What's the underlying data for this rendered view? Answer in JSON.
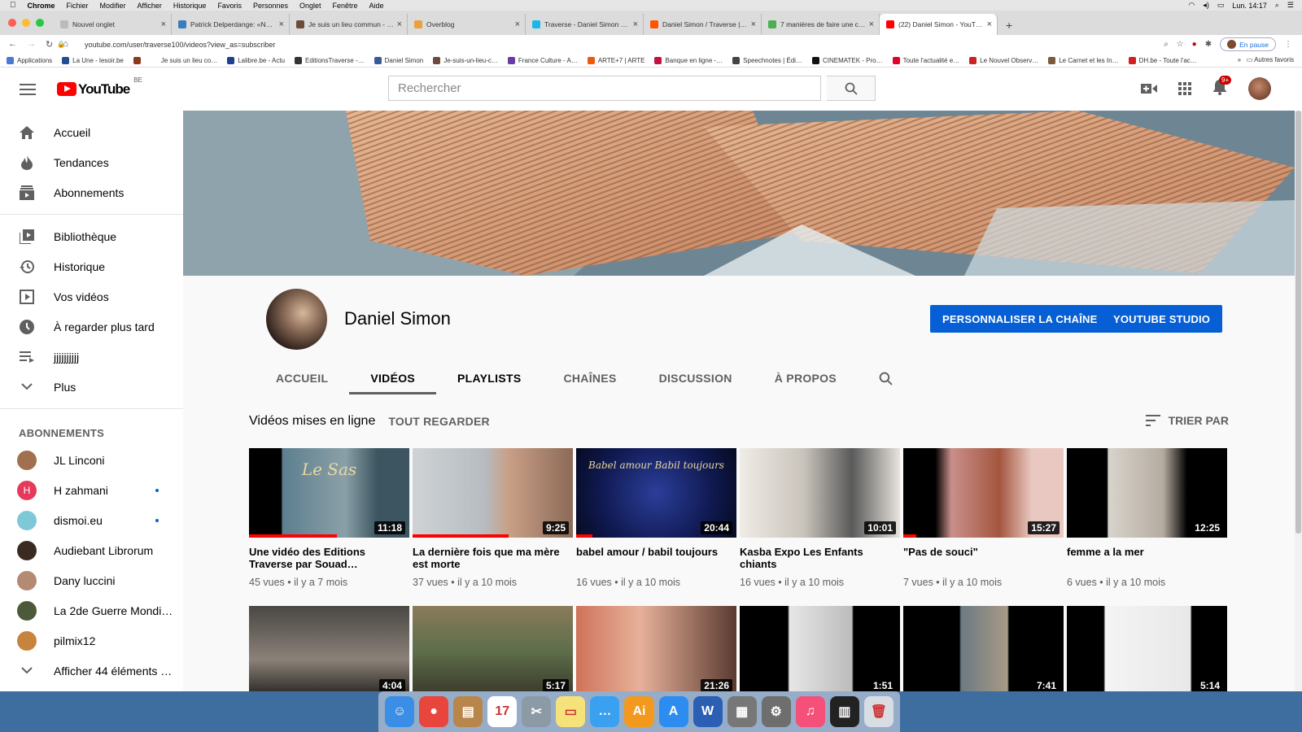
{
  "menubar": {
    "items": [
      "Chrome",
      "Fichier",
      "Modifier",
      "Afficher",
      "Historique",
      "Favoris",
      "Personnes",
      "Onglet",
      "Fenêtre",
      "Aide"
    ],
    "clock": "Lun. 14:17"
  },
  "tabs": [
    {
      "title": "Nouvel onglet",
      "color": "#bbbbbb"
    },
    {
      "title": "Patrick Delperdange: «Nous a…",
      "color": "#3b7bbf"
    },
    {
      "title": "Je suis un lieu commun - Jour…",
      "color": "#6d4b3b"
    },
    {
      "title": "Overblog",
      "color": "#e9a23b"
    },
    {
      "title": "Traverse - Daniel Simon sur Vi…",
      "color": "#1ab7ea"
    },
    {
      "title": "Daniel Simon / Traverse | Écou…",
      "color": "#ff5500"
    },
    {
      "title": "7 manières de faire une captu…",
      "color": "#4caf50"
    },
    {
      "title": "(22) Daniel Simon - YouTube",
      "color": "#ff0000"
    }
  ],
  "address": {
    "url": "youtube.com/user/traverse100/videos?view_as=subscriber",
    "pause": "En pause"
  },
  "bookmarks": [
    {
      "label": "Applications",
      "color": "#4a78d4"
    },
    {
      "label": "La Une - lesoir.be",
      "color": "#1f4f8f"
    },
    {
      "label": "",
      "color": "#8a3b1f"
    },
    {
      "label": "Je suis un lieu co…",
      "color": "#ffffff"
    },
    {
      "label": "Lalibre.be - Actu",
      "color": "#1f3f8f"
    },
    {
      "label": "EditionsTraverse -…",
      "color": "#333333"
    },
    {
      "label": "Daniel Simon",
      "color": "#3b5998"
    },
    {
      "label": "Je-suis-un-lieu-c…",
      "color": "#6d4b3b"
    },
    {
      "label": "France Culture - A…",
      "color": "#6a3ba0"
    },
    {
      "label": "ARTE+7 | ARTE",
      "color": "#ea5b0c"
    },
    {
      "label": "Banque en ligne -…",
      "color": "#c0143c"
    },
    {
      "label": "Speechnotes | Édi…",
      "color": "#444444"
    },
    {
      "label": "CINEMATEK - Pro…",
      "color": "#111111"
    },
    {
      "label": "Toute l'actualité e…",
      "color": "#e0002a"
    },
    {
      "label": "Le Nouvel Observ…",
      "color": "#cc2222"
    },
    {
      "label": "Le Carnet et les In…",
      "color": "#7a5a3a"
    },
    {
      "label": "DH.be - Toute l'ac…",
      "color": "#d02020"
    }
  ],
  "bookmarks_other": "Autres favoris",
  "youtube": {
    "logo": "YouTube",
    "region": "BE",
    "search_placeholder": "Rechercher",
    "notif_count": "9+"
  },
  "sidebar": {
    "main": [
      "Accueil",
      "Tendances",
      "Abonnements"
    ],
    "library": [
      "Bibliothèque",
      "Historique",
      "Vos vidéos",
      "À regarder plus tard",
      "jjjjjjjjjj",
      "Plus"
    ],
    "subs_heading": "ABONNEMENTS",
    "subs": [
      {
        "name": "JL Linconi",
        "color": "#a0704f",
        "dot": false
      },
      {
        "name": "H zahmani",
        "color": "#e53a5c",
        "dot": true,
        "letter": "H"
      },
      {
        "name": "dismoi.eu",
        "color": "#7fc8d8",
        "dot": true
      },
      {
        "name": "Audiebant Librorum",
        "color": "#3a2b22",
        "dot": false
      },
      {
        "name": "Dany luccini",
        "color": "#b48a72",
        "dot": false
      },
      {
        "name": "La 2de Guerre Mondi…",
        "color": "#4d5a3a",
        "dot": false
      },
      {
        "name": "pilmix12",
        "color": "#c8843f",
        "dot": false
      }
    ],
    "show_more": "Afficher 44 éléments …"
  },
  "channel": {
    "name": "Daniel Simon",
    "btn_customize": "PERSONNALISER LA CHAÎNE",
    "btn_studio": "YOUTUBE STUDIO",
    "tabs": [
      "ACCUEIL",
      "VIDÉOS",
      "PLAYLISTS",
      "CHAÎNES",
      "DISCUSSION",
      "À PROPOS"
    ]
  },
  "videos_section": {
    "title": "Vidéos mises en ligne",
    "play_all": "TOUT REGARDER",
    "sort": "TRIER PAR"
  },
  "videos": [
    {
      "title": "Une vidéo des Editions Traverse par Souad…",
      "meta": "45 vues • il y a 7 mois",
      "duration": "11:18",
      "progress": 0.55,
      "bg": "linear-gradient(90deg,#000 20%,#5d7f8f 21%,#8aa0a8 60%,#3c5560 80%)",
      "label": "Le Sas"
    },
    {
      "title": "La dernière fois que ma mère est morte",
      "meta": "37 vues • il y a 10 mois",
      "duration": "9:25",
      "progress": 0.6,
      "bg": "linear-gradient(90deg,#cfd3d6 0%,#b6bcc0 45%,#c99f86 60%,#8b6a57 100%)",
      "label": ""
    },
    {
      "title": "babel amour / babil toujours",
      "meta": "16 vues • il y a 10 mois",
      "duration": "20:44",
      "progress": 0.1,
      "bg": "radial-gradient(circle at 50% 50%,#2b3e9a 0%,#101a52 60%,#050a20 100%)",
      "label": "Babel amour  Babil toujours"
    },
    {
      "title": "Kasba Expo Les Enfants chiants",
      "meta": "16 vues • il y a 10 mois",
      "duration": "10:01",
      "progress": 0,
      "bg": "linear-gradient(90deg,#f0ece6 0%,#c9c3bb 40%,#5a5a5a 70%,#e8e4de 100%)",
      "label": ""
    },
    {
      "title": "\"Pas de souci\"",
      "meta": "7 vues • il y a 10 mois",
      "duration": "15:27",
      "progress": 0.08,
      "bg": "linear-gradient(90deg,#000 20%,#c98f8a 30%,#a4563f 60%,#e8c8c0 80%)",
      "label": ""
    },
    {
      "title": "femme a la mer",
      "meta": "6 vues • il y a 10 mois",
      "duration": "12:25",
      "progress": 0,
      "bg": "linear-gradient(90deg,#000 25%,#d8d3cc 26%,#b5aca0 60%,#000 75%)",
      "label": ""
    }
  ],
  "videos_row2": [
    {
      "duration": "4:04",
      "bg": "linear-gradient(180deg,#4a4744 0%,#8b8178 60%,#2a2724 100%)"
    },
    {
      "duration": "5:17",
      "bg": "linear-gradient(180deg,#8a7b5a 0%,#5e6e4a 50%,#3a3a2a 100%)"
    },
    {
      "duration": "21:26",
      "bg": "linear-gradient(90deg,#d0735a 0%,#e7b19a 40%,#5a3a30 100%)"
    },
    {
      "duration": "1:51",
      "bg": "linear-gradient(90deg,#000 30%,#e6e6e6 31%,#bcbcbc 70%,#000 71%)"
    },
    {
      "duration": "7:41",
      "bg": "linear-gradient(90deg,#000 35%,#6b7a82 36%,#a89a86 65%,#000 66%)"
    },
    {
      "duration": "5:14",
      "bg": "linear-gradient(90deg,#000 23%,#f4f4f4 24%,#e8e8e8 77%,#000 78%)"
    }
  ],
  "dock": [
    {
      "name": "finder-icon",
      "color": "#3a8ee6",
      "glyph": "☺"
    },
    {
      "name": "chrome-icon",
      "color": "#e8453c",
      "glyph": "●"
    },
    {
      "name": "book-icon",
      "color": "#b8864b",
      "glyph": "▤"
    },
    {
      "name": "calendar-icon",
      "color": "#ffffff",
      "glyph": "17"
    },
    {
      "name": "preview-icon",
      "color": "#8c9aa6",
      "glyph": "✂"
    },
    {
      "name": "notes-icon",
      "color": "#f5e27a",
      "glyph": "▭"
    },
    {
      "name": "messages-icon",
      "color": "#3aa0f0",
      "glyph": "…"
    },
    {
      "name": "illustrator-icon",
      "color": "#f39a1e",
      "glyph": "Ai"
    },
    {
      "name": "appstore-icon",
      "color": "#2d8cf0",
      "glyph": "A"
    },
    {
      "name": "word-icon",
      "color": "#2b5fb4",
      "glyph": "W"
    },
    {
      "name": "calculator-icon",
      "color": "#777777",
      "glyph": "▦"
    },
    {
      "name": "system-prefs-icon",
      "color": "#6e6e6e",
      "glyph": "⚙"
    },
    {
      "name": "music-icon",
      "color": "#f4507a",
      "glyph": "♫"
    },
    {
      "name": "piano-icon",
      "color": "#222222",
      "glyph": "▥"
    },
    {
      "name": "trash-icon",
      "color": "#d8dde3",
      "glyph": "🗑"
    }
  ]
}
